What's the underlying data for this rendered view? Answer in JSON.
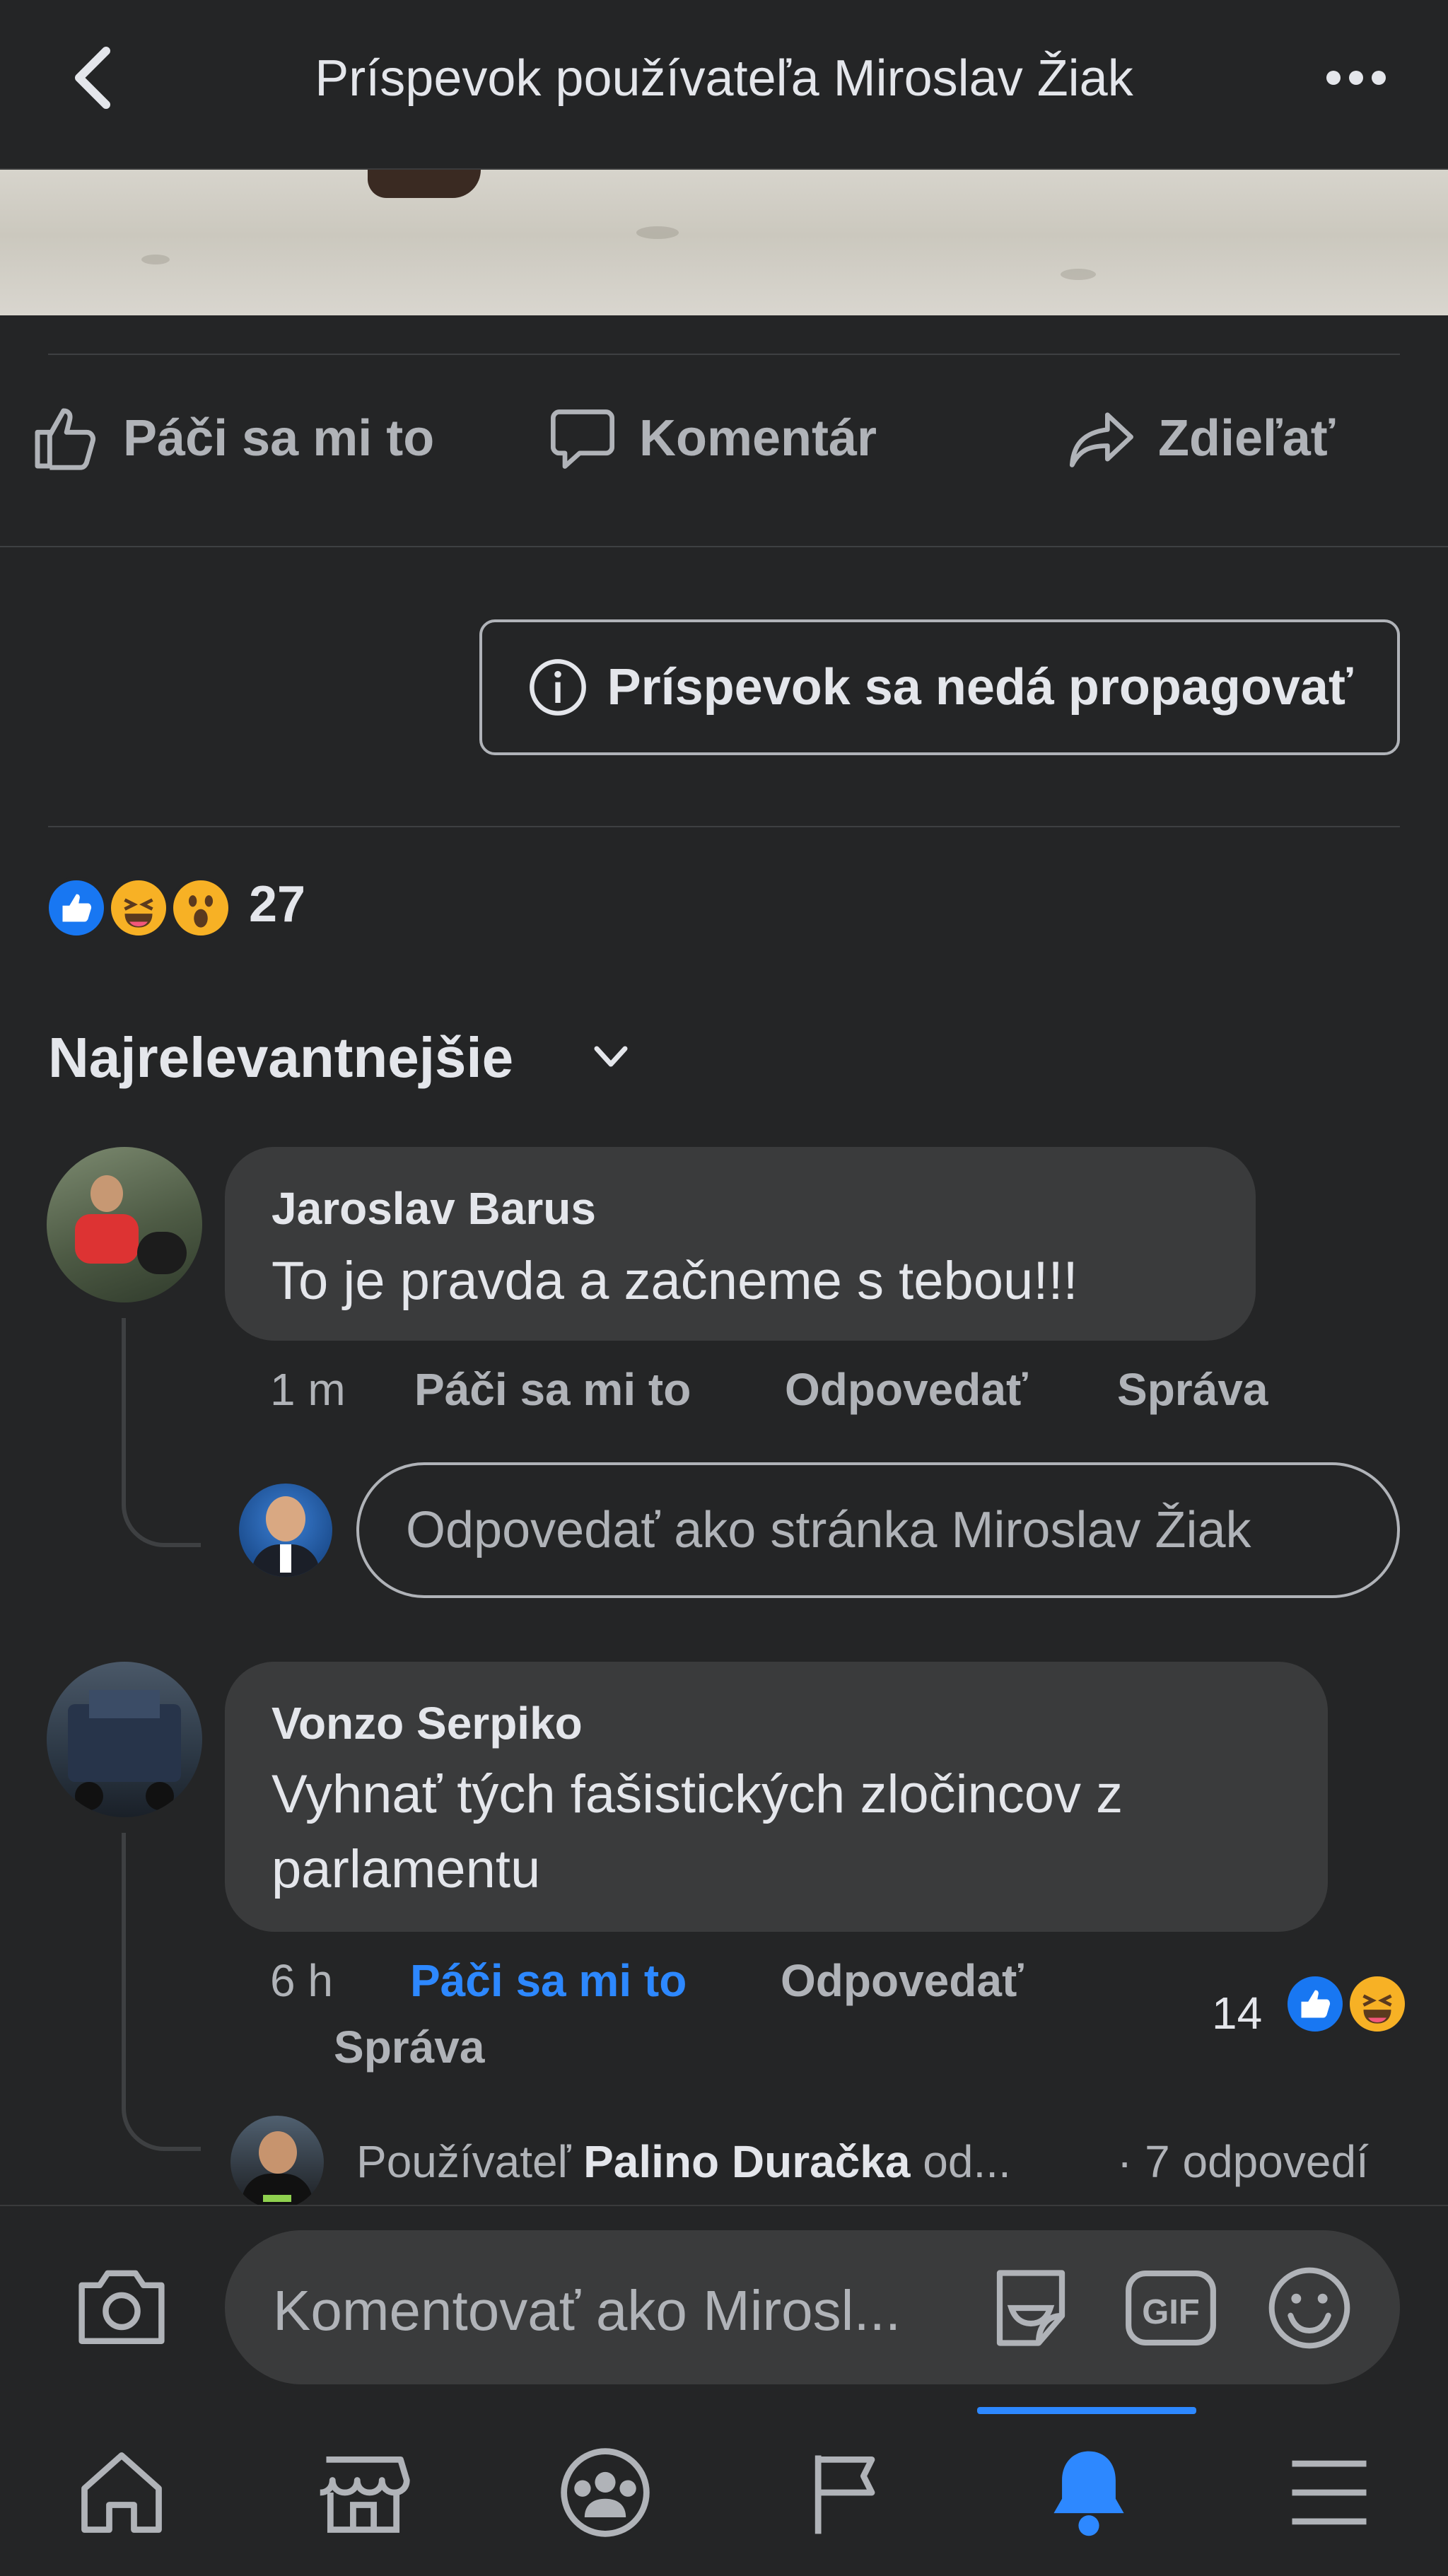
{
  "header": {
    "title": "Príspevok používateľa Miroslav Žiak"
  },
  "actions": {
    "like": "Páči sa mi to",
    "comment": "Komentár",
    "share": "Zdieľať"
  },
  "promote": {
    "label": "Príspevok sa nedá propagovať"
  },
  "reactions": {
    "count": "27",
    "types": [
      "like",
      "haha",
      "wow"
    ]
  },
  "sort": {
    "label": "Najrelevantnejšie"
  },
  "comments": [
    {
      "author": "Jaroslav Barus",
      "text": "To je pravda a začneme s tebou!!!",
      "time": "1 m",
      "like": "Páči sa mi to",
      "reply": "Odpovedať",
      "message": "Správa"
    },
    {
      "author": "Vonzo Serpiko",
      "text_line1": "Vyhnať tých fašistických zločincov z",
      "text_line2": "parlamentu",
      "time": "6 h",
      "like": "Páči sa mi to",
      "reply": "Odpovedať",
      "message": "Správa",
      "reaction_count": "14",
      "reaction_types": [
        "like",
        "haha"
      ]
    }
  ],
  "reply_box": {
    "placeholder": "Odpovedať ako stránka Miroslav Žiak"
  },
  "replies_summary": {
    "prefix": "Používateľ",
    "name": "Palino Duračka",
    "suffix": "od...",
    "count": "· 7 odpovedí"
  },
  "composer": {
    "placeholder": "Komentovať ako Mirosl..."
  },
  "nav": {
    "items": [
      "home-icon",
      "marketplace-icon",
      "groups-icon",
      "pages-flag-icon",
      "notifications-bell-icon",
      "menu-icon"
    ],
    "active": "notifications-bell-icon"
  },
  "colors": {
    "accent": "#2d88ff",
    "background": "#242526",
    "bubble": "#3a3b3c"
  }
}
